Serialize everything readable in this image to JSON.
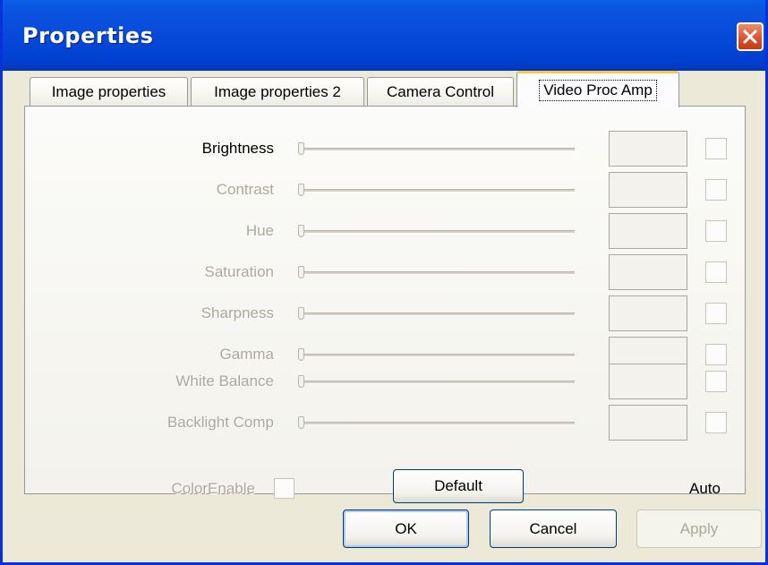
{
  "window": {
    "title": "Properties",
    "close_icon": "close-icon",
    "colors": {
      "titlebar": "#0a55e0",
      "close": "#dd4f2a",
      "face": "#ece9d8",
      "active_tab_accent": "#ffc83c"
    }
  },
  "tabs": [
    {
      "label": "Image properties",
      "active": false
    },
    {
      "label": "Image properties 2",
      "active": false
    },
    {
      "label": "Camera Control",
      "active": false
    },
    {
      "label": "Video Proc Amp",
      "active": true
    }
  ],
  "controls": [
    {
      "label": "Brightness",
      "enabled": true,
      "value": ""
    },
    {
      "label": "Contrast",
      "enabled": false,
      "value": ""
    },
    {
      "label": "Hue",
      "enabled": false,
      "value": ""
    },
    {
      "label": "Saturation",
      "enabled": false,
      "value": ""
    },
    {
      "label": "Sharpness",
      "enabled": false,
      "value": ""
    },
    {
      "label": "Gamma",
      "enabled": false,
      "value": ""
    },
    {
      "label": "White Balance",
      "enabled": false,
      "value": ""
    },
    {
      "label": "Backlight Comp",
      "enabled": false,
      "value": ""
    }
  ],
  "color_enable": {
    "label": "ColorEnable",
    "checked": false
  },
  "auto_label": "Auto",
  "default_button": "Default",
  "buttons": {
    "ok": "OK",
    "cancel": "Cancel",
    "apply": "Apply"
  }
}
